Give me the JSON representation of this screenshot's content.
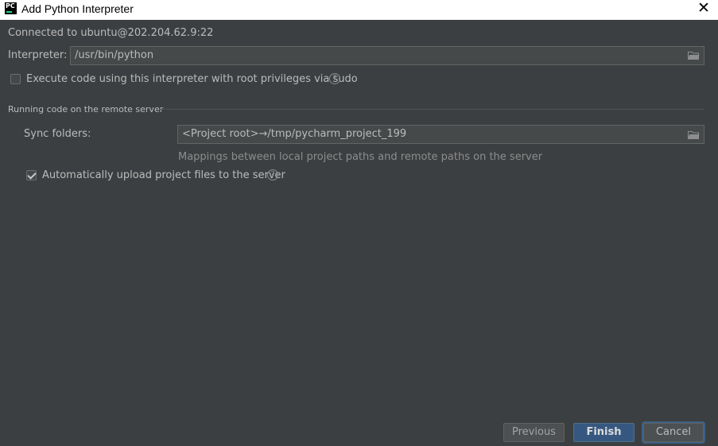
{
  "window": {
    "app_icon_text": "PC",
    "title": "Add Python Interpreter",
    "close_glyph": "✕"
  },
  "connection": {
    "status": "Connected to ubuntu@202.204.62.9:22"
  },
  "interpreter": {
    "label": "Interpreter:",
    "value": "/usr/bin/python",
    "sudo_label": "Execute code using this interpreter with root privileges via sudo",
    "sudo_checked": false
  },
  "remote": {
    "section_title": "Running code on the remote server",
    "sync_label": "Sync folders:",
    "sync_value": "<Project root>→/tmp/pycharm_project_199",
    "sync_hint": "Mappings between local project paths and remote paths on the server",
    "auto_upload_label": "Automatically upload project files to the server",
    "auto_upload_checked": true
  },
  "help_glyph": "?",
  "icons": {
    "folder": "folder-icon",
    "help": "help-icon",
    "close": "close-icon",
    "checkmark": "checkmark-icon"
  },
  "buttons": {
    "previous": "Previous",
    "finish": "Finish",
    "cancel": "Cancel"
  },
  "colors": {
    "background": "#3c3f41",
    "accent": "#365880",
    "logo_green": "#21d789"
  }
}
